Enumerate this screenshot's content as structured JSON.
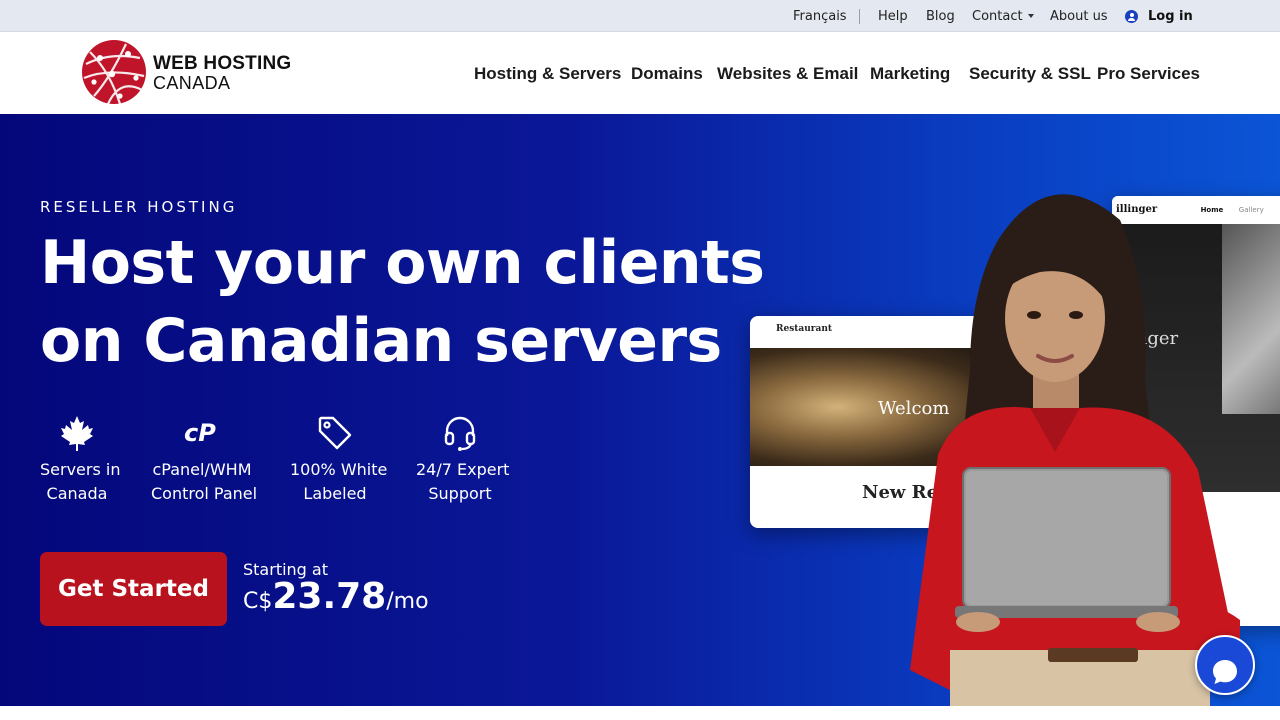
{
  "topbar": {
    "language": "Français",
    "help": "Help",
    "blog": "Blog",
    "contact": "Contact",
    "about": "About us",
    "login": "Log in"
  },
  "brand": {
    "line1": "WEB HOSTING",
    "line2": "CANADA",
    "logo_color": "#c0142b"
  },
  "nav": {
    "items": [
      "Hosting & Servers",
      "Domains",
      "Websites & Email",
      "Marketing",
      "Security & SSL",
      "Pro Services"
    ]
  },
  "hero": {
    "eyebrow": "RESELLER HOSTING",
    "headline_1": "Host your own clients",
    "headline_2": "on Canadian servers",
    "features": [
      {
        "icon": "maple-leaf-icon",
        "line1": "Servers in",
        "line2": "Canada"
      },
      {
        "icon": "cpanel-icon",
        "line1": "cPanel/WHM",
        "line2": "Control Panel"
      },
      {
        "icon": "tag-icon",
        "line1": "100% White",
        "line2": "Labeled"
      },
      {
        "icon": "headset-icon",
        "line1": "24/7 Expert",
        "line2": "Support"
      }
    ],
    "cta": "Get Started",
    "price_label": "Starting at",
    "price_currency": "C$",
    "price_amount": "23.78",
    "price_period": "/mo",
    "colors": {
      "gradient_start": "#04077a",
      "gradient_end": "#0b55d6",
      "cta": "#b8121f"
    }
  },
  "mockups": {
    "back_title": "illinger",
    "back_nav": "Home",
    "back_nav_2": "Gallery",
    "back_overlay": "inger",
    "front_title": "Restaurant",
    "front_welcome": "Welcom",
    "front_heading": "New Re"
  },
  "chat": {
    "icon": "chat-bubble-icon"
  }
}
